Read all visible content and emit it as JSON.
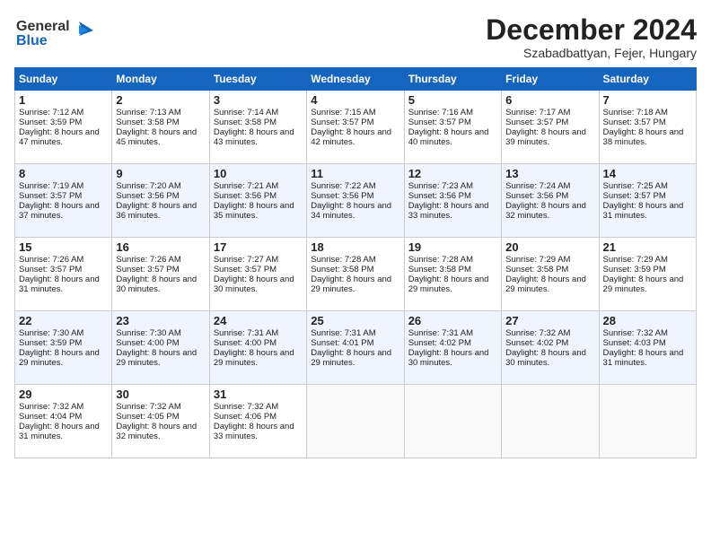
{
  "logo": {
    "line1": "General",
    "line2": "Blue"
  },
  "title": "December 2024",
  "subtitle": "Szabadbattyan, Fejer, Hungary",
  "days_of_week": [
    "Sunday",
    "Monday",
    "Tuesday",
    "Wednesday",
    "Thursday",
    "Friday",
    "Saturday"
  ],
  "weeks": [
    [
      {
        "day": "1",
        "sunrise": "Sunrise: 7:12 AM",
        "sunset": "Sunset: 3:59 PM",
        "daylight": "Daylight: 8 hours and 47 minutes."
      },
      {
        "day": "2",
        "sunrise": "Sunrise: 7:13 AM",
        "sunset": "Sunset: 3:58 PM",
        "daylight": "Daylight: 8 hours and 45 minutes."
      },
      {
        "day": "3",
        "sunrise": "Sunrise: 7:14 AM",
        "sunset": "Sunset: 3:58 PM",
        "daylight": "Daylight: 8 hours and 43 minutes."
      },
      {
        "day": "4",
        "sunrise": "Sunrise: 7:15 AM",
        "sunset": "Sunset: 3:57 PM",
        "daylight": "Daylight: 8 hours and 42 minutes."
      },
      {
        "day": "5",
        "sunrise": "Sunrise: 7:16 AM",
        "sunset": "Sunset: 3:57 PM",
        "daylight": "Daylight: 8 hours and 40 minutes."
      },
      {
        "day": "6",
        "sunrise": "Sunrise: 7:17 AM",
        "sunset": "Sunset: 3:57 PM",
        "daylight": "Daylight: 8 hours and 39 minutes."
      },
      {
        "day": "7",
        "sunrise": "Sunrise: 7:18 AM",
        "sunset": "Sunset: 3:57 PM",
        "daylight": "Daylight: 8 hours and 38 minutes."
      }
    ],
    [
      {
        "day": "8",
        "sunrise": "Sunrise: 7:19 AM",
        "sunset": "Sunset: 3:57 PM",
        "daylight": "Daylight: 8 hours and 37 minutes."
      },
      {
        "day": "9",
        "sunrise": "Sunrise: 7:20 AM",
        "sunset": "Sunset: 3:56 PM",
        "daylight": "Daylight: 8 hours and 36 minutes."
      },
      {
        "day": "10",
        "sunrise": "Sunrise: 7:21 AM",
        "sunset": "Sunset: 3:56 PM",
        "daylight": "Daylight: 8 hours and 35 minutes."
      },
      {
        "day": "11",
        "sunrise": "Sunrise: 7:22 AM",
        "sunset": "Sunset: 3:56 PM",
        "daylight": "Daylight: 8 hours and 34 minutes."
      },
      {
        "day": "12",
        "sunrise": "Sunrise: 7:23 AM",
        "sunset": "Sunset: 3:56 PM",
        "daylight": "Daylight: 8 hours and 33 minutes."
      },
      {
        "day": "13",
        "sunrise": "Sunrise: 7:24 AM",
        "sunset": "Sunset: 3:56 PM",
        "daylight": "Daylight: 8 hours and 32 minutes."
      },
      {
        "day": "14",
        "sunrise": "Sunrise: 7:25 AM",
        "sunset": "Sunset: 3:57 PM",
        "daylight": "Daylight: 8 hours and 31 minutes."
      }
    ],
    [
      {
        "day": "15",
        "sunrise": "Sunrise: 7:26 AM",
        "sunset": "Sunset: 3:57 PM",
        "daylight": "Daylight: 8 hours and 31 minutes."
      },
      {
        "day": "16",
        "sunrise": "Sunrise: 7:26 AM",
        "sunset": "Sunset: 3:57 PM",
        "daylight": "Daylight: 8 hours and 30 minutes."
      },
      {
        "day": "17",
        "sunrise": "Sunrise: 7:27 AM",
        "sunset": "Sunset: 3:57 PM",
        "daylight": "Daylight: 8 hours and 30 minutes."
      },
      {
        "day": "18",
        "sunrise": "Sunrise: 7:28 AM",
        "sunset": "Sunset: 3:58 PM",
        "daylight": "Daylight: 8 hours and 29 minutes."
      },
      {
        "day": "19",
        "sunrise": "Sunrise: 7:28 AM",
        "sunset": "Sunset: 3:58 PM",
        "daylight": "Daylight: 8 hours and 29 minutes."
      },
      {
        "day": "20",
        "sunrise": "Sunrise: 7:29 AM",
        "sunset": "Sunset: 3:58 PM",
        "daylight": "Daylight: 8 hours and 29 minutes."
      },
      {
        "day": "21",
        "sunrise": "Sunrise: 7:29 AM",
        "sunset": "Sunset: 3:59 PM",
        "daylight": "Daylight: 8 hours and 29 minutes."
      }
    ],
    [
      {
        "day": "22",
        "sunrise": "Sunrise: 7:30 AM",
        "sunset": "Sunset: 3:59 PM",
        "daylight": "Daylight: 8 hours and 29 minutes."
      },
      {
        "day": "23",
        "sunrise": "Sunrise: 7:30 AM",
        "sunset": "Sunset: 4:00 PM",
        "daylight": "Daylight: 8 hours and 29 minutes."
      },
      {
        "day": "24",
        "sunrise": "Sunrise: 7:31 AM",
        "sunset": "Sunset: 4:00 PM",
        "daylight": "Daylight: 8 hours and 29 minutes."
      },
      {
        "day": "25",
        "sunrise": "Sunrise: 7:31 AM",
        "sunset": "Sunset: 4:01 PM",
        "daylight": "Daylight: 8 hours and 29 minutes."
      },
      {
        "day": "26",
        "sunrise": "Sunrise: 7:31 AM",
        "sunset": "Sunset: 4:02 PM",
        "daylight": "Daylight: 8 hours and 30 minutes."
      },
      {
        "day": "27",
        "sunrise": "Sunrise: 7:32 AM",
        "sunset": "Sunset: 4:02 PM",
        "daylight": "Daylight: 8 hours and 30 minutes."
      },
      {
        "day": "28",
        "sunrise": "Sunrise: 7:32 AM",
        "sunset": "Sunset: 4:03 PM",
        "daylight": "Daylight: 8 hours and 31 minutes."
      }
    ],
    [
      {
        "day": "29",
        "sunrise": "Sunrise: 7:32 AM",
        "sunset": "Sunset: 4:04 PM",
        "daylight": "Daylight: 8 hours and 31 minutes."
      },
      {
        "day": "30",
        "sunrise": "Sunrise: 7:32 AM",
        "sunset": "Sunset: 4:05 PM",
        "daylight": "Daylight: 8 hours and 32 minutes."
      },
      {
        "day": "31",
        "sunrise": "Sunrise: 7:32 AM",
        "sunset": "Sunset: 4:06 PM",
        "daylight": "Daylight: 8 hours and 33 minutes."
      },
      null,
      null,
      null,
      null
    ]
  ]
}
